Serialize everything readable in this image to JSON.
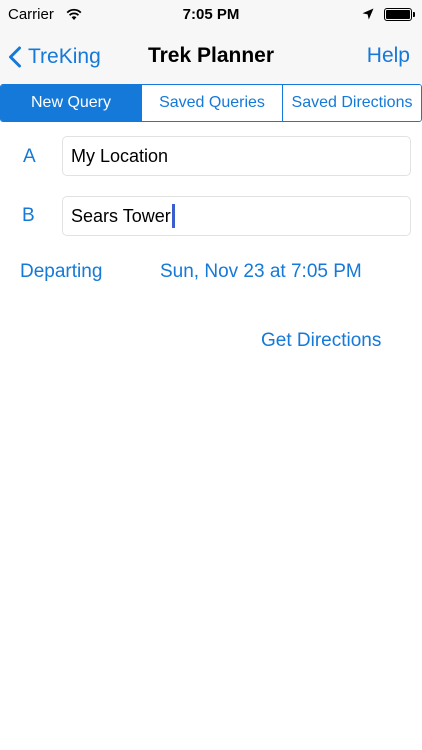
{
  "status_bar": {
    "carrier": "Carrier",
    "time": "7:05 PM",
    "icons": [
      "wifi-icon",
      "location-arrow-icon",
      "battery-icon"
    ]
  },
  "nav": {
    "back_label": "TreKing",
    "title": "Trek Planner",
    "help_label": "Help"
  },
  "tabs": [
    {
      "label": "New Query",
      "selected": true
    },
    {
      "label": "Saved Queries",
      "selected": false
    },
    {
      "label": "Saved Directions",
      "selected": false
    }
  ],
  "form": {
    "a": {
      "label": "A",
      "value": "My Location"
    },
    "b": {
      "label": "B",
      "value": "Sears Tower"
    },
    "departing_label": "Departing",
    "departing_value": "Sun, Nov 23 at 7:05 PM",
    "get_directions_label": "Get Directions"
  },
  "colors": {
    "accent": "#1479d8",
    "bar_background": "#f7f7f7"
  }
}
